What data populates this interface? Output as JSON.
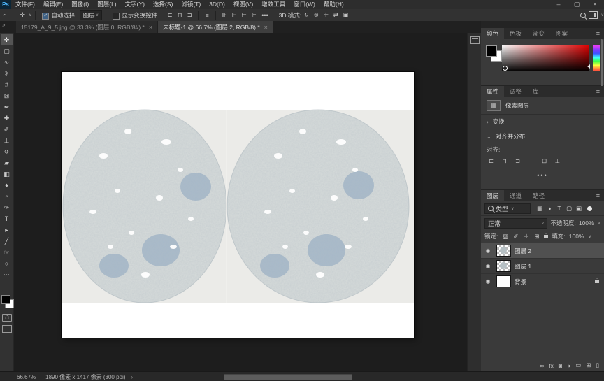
{
  "window": {
    "minimize": "–",
    "maximize": "▢",
    "close": "×"
  },
  "icons": {
    "close": "×",
    "caret": "∨",
    "small_caret": "∨",
    "menu": "≡",
    "chevrons": "»",
    "eye": "◉",
    "ellipsis": "⋯",
    "dots": "•••",
    "check": "✓",
    "home": "⌂",
    "arrow": "›",
    "collapse": "›",
    "expand": "⌄",
    "move": "✛",
    "toggle_dot": "●"
  },
  "colors": {
    "foreground": "#000000",
    "background": "#ffffff",
    "picker_hue": "#e00000"
  },
  "menubar": {
    "logo": "Ps",
    "items": [
      {
        "label": "文件(F)"
      },
      {
        "label": "编辑(E)"
      },
      {
        "label": "图像(I)"
      },
      {
        "label": "图层(L)"
      },
      {
        "label": "文字(Y)"
      },
      {
        "label": "选择(S)"
      },
      {
        "label": "滤镜(T)"
      },
      {
        "label": "3D(D)"
      },
      {
        "label": "视图(V)"
      },
      {
        "label": "增效工具"
      },
      {
        "label": "窗口(W)"
      },
      {
        "label": "帮助(H)"
      }
    ]
  },
  "options": {
    "auto_select_label": "自动选择:",
    "auto_select_value": "图层",
    "show_transform_label": "显示变换控件",
    "mode_3d_label": "3D 模式:",
    "align_icons": [
      {
        "name": "align-left-icon",
        "glyph": "⊏"
      },
      {
        "name": "align-center-icon",
        "glyph": "⊓"
      },
      {
        "name": "align-right-icon",
        "glyph": "⊐"
      }
    ],
    "single_icon": [
      {
        "name": "align-top-icon",
        "glyph": "≡"
      }
    ],
    "distribute_icons": [
      {
        "name": "distribute-left-icon",
        "glyph": "⊪"
      },
      {
        "name": "distribute-center-icon",
        "glyph": "⊩"
      },
      {
        "name": "distribute-right-icon",
        "glyph": "⊨"
      },
      {
        "name": "distribute-bottom-icon",
        "glyph": "⊫"
      }
    ],
    "mode3d_icons": [
      {
        "name": "3d-rotate-icon",
        "glyph": "↻"
      },
      {
        "name": "3d-roll-icon",
        "glyph": "⊚"
      },
      {
        "name": "3d-drag-icon",
        "glyph": "✛"
      },
      {
        "name": "3d-slide-icon",
        "glyph": "⇄"
      },
      {
        "name": "3d-scale-icon",
        "glyph": "▣"
      }
    ]
  },
  "tabs": [
    {
      "title": "15179_A_9_5.jpg @ 33.3% (图层 0, RGB/8#) *",
      "active": false
    },
    {
      "title": "未标题-1 @ 66.7% (图层 2, RGB/8) *",
      "active": true
    }
  ],
  "tools": [
    {
      "name": "move-tool",
      "glyph": "✛",
      "selected": true
    },
    {
      "name": "marquee-tool",
      "glyph": "▢",
      "selected": false
    },
    {
      "name": "lasso-tool",
      "glyph": "∿",
      "selected": false
    },
    {
      "name": "object-selection-tool",
      "glyph": "✳",
      "selected": false
    },
    {
      "name": "crop-tool",
      "glyph": "#",
      "selected": false
    },
    {
      "name": "frame-tool",
      "glyph": "⊠",
      "selected": false
    },
    {
      "name": "eyedropper-tool",
      "glyph": "✒",
      "selected": false
    },
    {
      "name": "healing-brush-tool",
      "glyph": "✚",
      "selected": false
    },
    {
      "name": "brush-tool",
      "glyph": "✐",
      "selected": false
    },
    {
      "name": "clone-stamp-tool",
      "glyph": "⊥",
      "selected": false
    },
    {
      "name": "history-brush-tool",
      "glyph": "↺",
      "selected": false
    },
    {
      "name": "eraser-tool",
      "glyph": "▰",
      "selected": false
    },
    {
      "name": "gradient-tool",
      "glyph": "◧",
      "selected": false
    },
    {
      "name": "blur-tool",
      "glyph": "♦",
      "selected": false
    },
    {
      "name": "dodge-tool",
      "glyph": "◔",
      "selected": false
    },
    {
      "name": "pen-tool",
      "glyph": "✑",
      "selected": false
    },
    {
      "name": "type-tool",
      "glyph": "T",
      "selected": false
    },
    {
      "name": "path-selection-tool",
      "glyph": "▸",
      "selected": false
    },
    {
      "name": "shape-tool",
      "glyph": "╱",
      "selected": false
    },
    {
      "name": "hand-tool",
      "glyph": "☞",
      "selected": false
    },
    {
      "name": "zoom-tool",
      "glyph": "○",
      "selected": false
    },
    {
      "name": "edit-toolbar",
      "glyph": "⋯",
      "selected": false
    }
  ],
  "panels": {
    "color": {
      "tabs": [
        {
          "label": "颜色",
          "active": true
        },
        {
          "label": "色板",
          "active": false
        },
        {
          "label": "渐变",
          "active": false
        },
        {
          "label": "图案",
          "active": false
        }
      ]
    },
    "properties": {
      "tabs": [
        {
          "label": "属性",
          "active": true
        },
        {
          "label": "调整",
          "active": false
        },
        {
          "label": "库",
          "active": false
        }
      ],
      "layer_type": "像素图层",
      "transform_label": "变换",
      "align_distribute_label": "对齐并分布",
      "align_label": "对齐:",
      "align_icons": [
        {
          "name": "align-left-icon",
          "glyph": "⊏"
        },
        {
          "name": "align-hcenter-icon",
          "glyph": "⊓"
        },
        {
          "name": "align-right-icon",
          "glyph": "⊐"
        },
        {
          "name": "align-top-icon",
          "glyph": "⊤"
        },
        {
          "name": "align-vcenter-icon",
          "glyph": "⊟"
        },
        {
          "name": "align-bottom-icon",
          "glyph": "⊥"
        }
      ]
    },
    "layers": {
      "tabs": [
        {
          "label": "图层",
          "active": true
        },
        {
          "label": "通道",
          "active": false
        },
        {
          "label": "路径",
          "active": false
        }
      ],
      "filter_label": "类型",
      "filter_icons": [
        {
          "name": "filter-pixel-icon",
          "glyph": "▦"
        },
        {
          "name": "filter-adjustment-icon",
          "glyph": "◑"
        },
        {
          "name": "filter-type-icon",
          "glyph": "T"
        },
        {
          "name": "filter-shape-icon",
          "glyph": "▢"
        },
        {
          "name": "filter-smart-object-icon",
          "glyph": "▣"
        }
      ],
      "blend_mode": "正常",
      "opacity_label": "不透明度:",
      "opacity_value": "100%",
      "lock_label": "锁定:",
      "lock_icons": [
        {
          "name": "lock-transparent-icon",
          "glyph": "▨"
        },
        {
          "name": "lock-pixels-icon",
          "glyph": "✐"
        },
        {
          "name": "lock-position-icon",
          "glyph": "✛"
        },
        {
          "name": "lock-artboard-icon",
          "glyph": "⊞"
        }
      ],
      "fill_label": "填充:",
      "fill_value": "100%",
      "rows": [
        {
          "name": "图层 2",
          "selected": true,
          "background": false,
          "locked": false
        },
        {
          "name": "图层 1",
          "selected": false,
          "background": false,
          "locked": false
        },
        {
          "name": "背景",
          "selected": false,
          "background": true,
          "locked": true
        }
      ],
      "bottom_icons": [
        {
          "name": "link-layers-icon",
          "glyph": "∞"
        },
        {
          "name": "layer-effects-icon",
          "glyph": "fx"
        },
        {
          "name": "layer-mask-icon",
          "glyph": "◙"
        },
        {
          "name": "adjustment-layer-icon",
          "glyph": "◑"
        },
        {
          "name": "layer-group-icon",
          "glyph": "▭"
        },
        {
          "name": "new-layer-icon",
          "glyph": "⊞"
        },
        {
          "name": "delete-layer-icon",
          "glyph": "▯"
        }
      ]
    }
  },
  "statusbar": {
    "zoom": "66.67%",
    "doc_info": "1890 像素 x 1417 像素 (300 ppi)"
  }
}
